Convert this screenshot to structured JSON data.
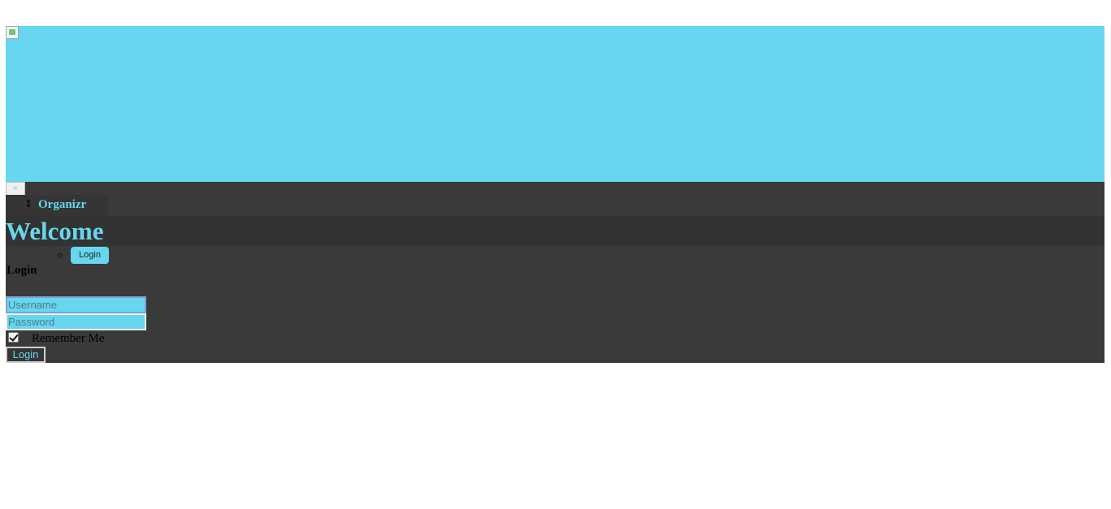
{
  "banner": {
    "image_icon": "broken-image-icon"
  },
  "close": {
    "label": "×"
  },
  "nav": {
    "brand": "Organizr",
    "login_label": "Login"
  },
  "welcome": {
    "title": "Welcome"
  },
  "form": {
    "title": "Login",
    "username_placeholder": "Username",
    "password_placeholder": "Password",
    "remember_label": "Remember Me",
    "remember_checked": true,
    "submit_label": "Login"
  },
  "colors": {
    "accent": "#66d7ee",
    "panel": "#3a3a3a",
    "band": "#333333"
  }
}
